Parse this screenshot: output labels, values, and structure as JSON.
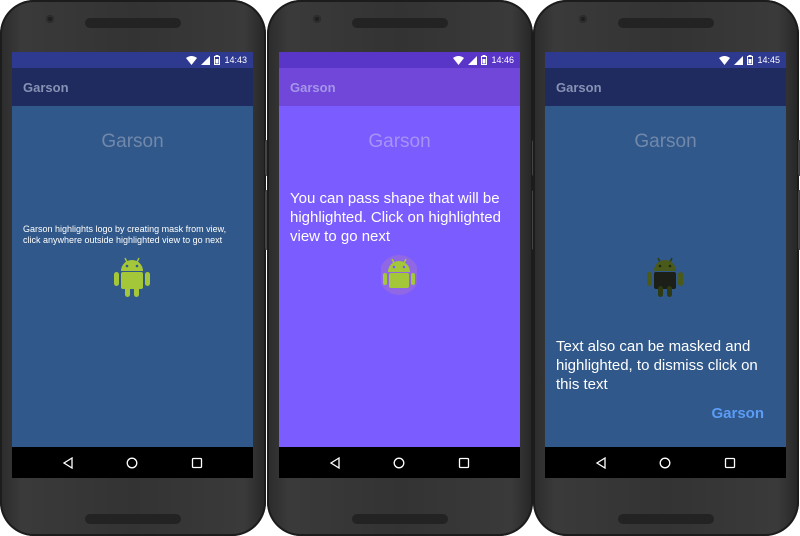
{
  "phones": [
    {
      "status_time": "14:43",
      "appbar_title": "Garson",
      "header_text": "Garson",
      "message": "Garson highlights logo by creating mask from view, click anywhere outside highlighted view to go next",
      "colors": {
        "statusbar": "#2e3990",
        "appbar": "#1f2a5e",
        "content": "#30588a"
      }
    },
    {
      "status_time": "14:46",
      "appbar_title": "Garson",
      "header_text": "Garson",
      "message": "You can pass shape that will be highlighted. Click on highlighted view to go next",
      "colors": {
        "statusbar": "#5a36c8",
        "appbar": "#7047d9",
        "content": "#7a5cff"
      }
    },
    {
      "status_time": "14:45",
      "appbar_title": "Garson",
      "header_text": "Garson",
      "message": "Text also can be masked and highlighted, to dismiss click on this text",
      "highlight_link": "Garson",
      "colors": {
        "statusbar": "#2e3990",
        "appbar": "#1f2a5e",
        "content": "#30588a",
        "link": "#5b9cf5"
      }
    }
  ],
  "icons": [
    "wifi-icon",
    "signal-icon",
    "battery-icon",
    "android-logo-icon",
    "back-icon",
    "home-icon",
    "recents-icon"
  ]
}
